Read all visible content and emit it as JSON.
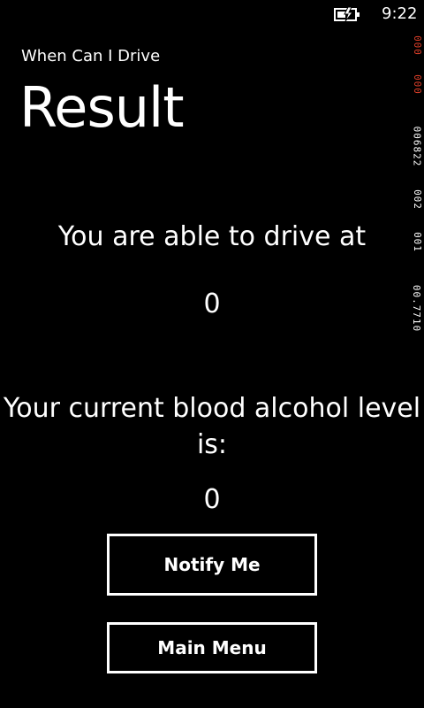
{
  "status_bar": {
    "time": "9:22",
    "battery_icon": "battery-charging-icon"
  },
  "header": {
    "app_title": "When Can I Drive",
    "page_title": "Result"
  },
  "result": {
    "drive_label": "You are able to drive at",
    "drive_value": "0",
    "bac_label": "Your current blood alcohol level is:",
    "bac_value": "0"
  },
  "buttons": {
    "notify_label": "Notify Me",
    "main_menu_label": "Main Menu"
  },
  "frame_rate_counters": [
    {
      "text": "000",
      "color": "#e0402a"
    },
    {
      "text": "000",
      "color": "#e0402a"
    },
    {
      "text": "006822",
      "color": "#ffffff"
    },
    {
      "text": "002",
      "color": "#ffffff"
    },
    {
      "text": "001",
      "color": "#ffffff"
    },
    {
      "text": "00.7710",
      "color": "#ffffff"
    }
  ]
}
